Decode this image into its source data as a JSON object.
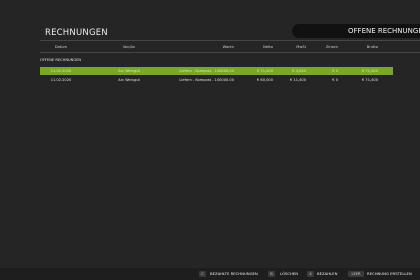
{
  "header": {
    "title": "RECHNUNGEN",
    "active_tab": "OFFENE RECHNUNGEN"
  },
  "table": {
    "columns": {
      "date": "Datum",
      "vendor": "Von/An",
      "goods": "Waren",
      "net": "Netto",
      "vat": "MwSt",
      "interest": "Zinsen",
      "gross": "Brutto"
    },
    "section_label": "OFFENE RECHNUNGEN",
    "rows": [
      {
        "date": "11.02.2020",
        "vendor": "Arc Weingut",
        "goods": "Liefern - Kompost - 100000.00",
        "net": "€ 71,400",
        "vat": "€ 4,000",
        "interest": "€ 0",
        "gross": "€ 71,400"
      },
      {
        "date": "11.02.2020",
        "vendor": "Arc Weingut",
        "goods": "Liefern - Kompost - 100000.00",
        "net": "€ 60,000",
        "vat": "€ 11,400",
        "interest": "€ 0",
        "gross": "€ 71,400"
      }
    ]
  },
  "footer": {
    "actions": [
      {
        "key": "C",
        "label": "BEZAHLTE RECHNUNGEN"
      },
      {
        "key": "B",
        "label": "LÖSCHEN"
      },
      {
        "key": "X",
        "label": "BEZAHLEN"
      },
      {
        "key": "LEER",
        "label": "RECHNUNG ERSTELLEN"
      }
    ]
  },
  "colors": {
    "accent": "#7aa72a",
    "background": "#252525",
    "tab_background": "#111111"
  }
}
